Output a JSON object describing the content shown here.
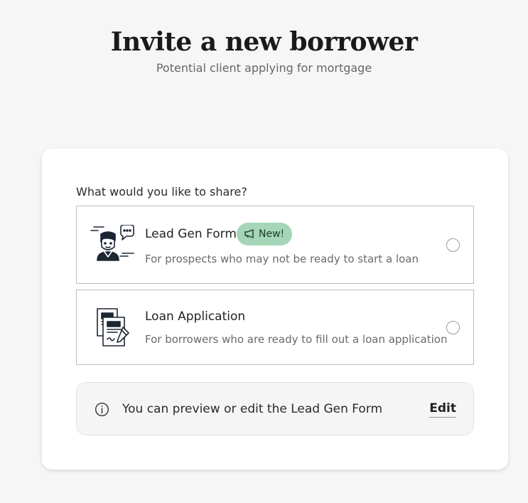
{
  "header": {
    "title": "Invite a new borrower",
    "subtitle": "Potential client applying for mortgage"
  },
  "card": {
    "question": "What would you like to share?",
    "options": [
      {
        "icon": "lead-gen-person-chat-icon",
        "title": "Lead Gen Form",
        "badge": "New!",
        "badge_icon": "megaphone-icon",
        "badge_color": "#a4d6b7",
        "description": "For prospects who may not be ready to start a loan",
        "selected": false
      },
      {
        "icon": "loan-documents-icon",
        "title": "Loan Application",
        "description": "For borrowers who are ready to fill out a loan application",
        "selected": false
      }
    ],
    "info": {
      "icon": "info-icon",
      "text": "You can preview or edit the Lead Gen Form",
      "link_label": "Edit"
    }
  }
}
